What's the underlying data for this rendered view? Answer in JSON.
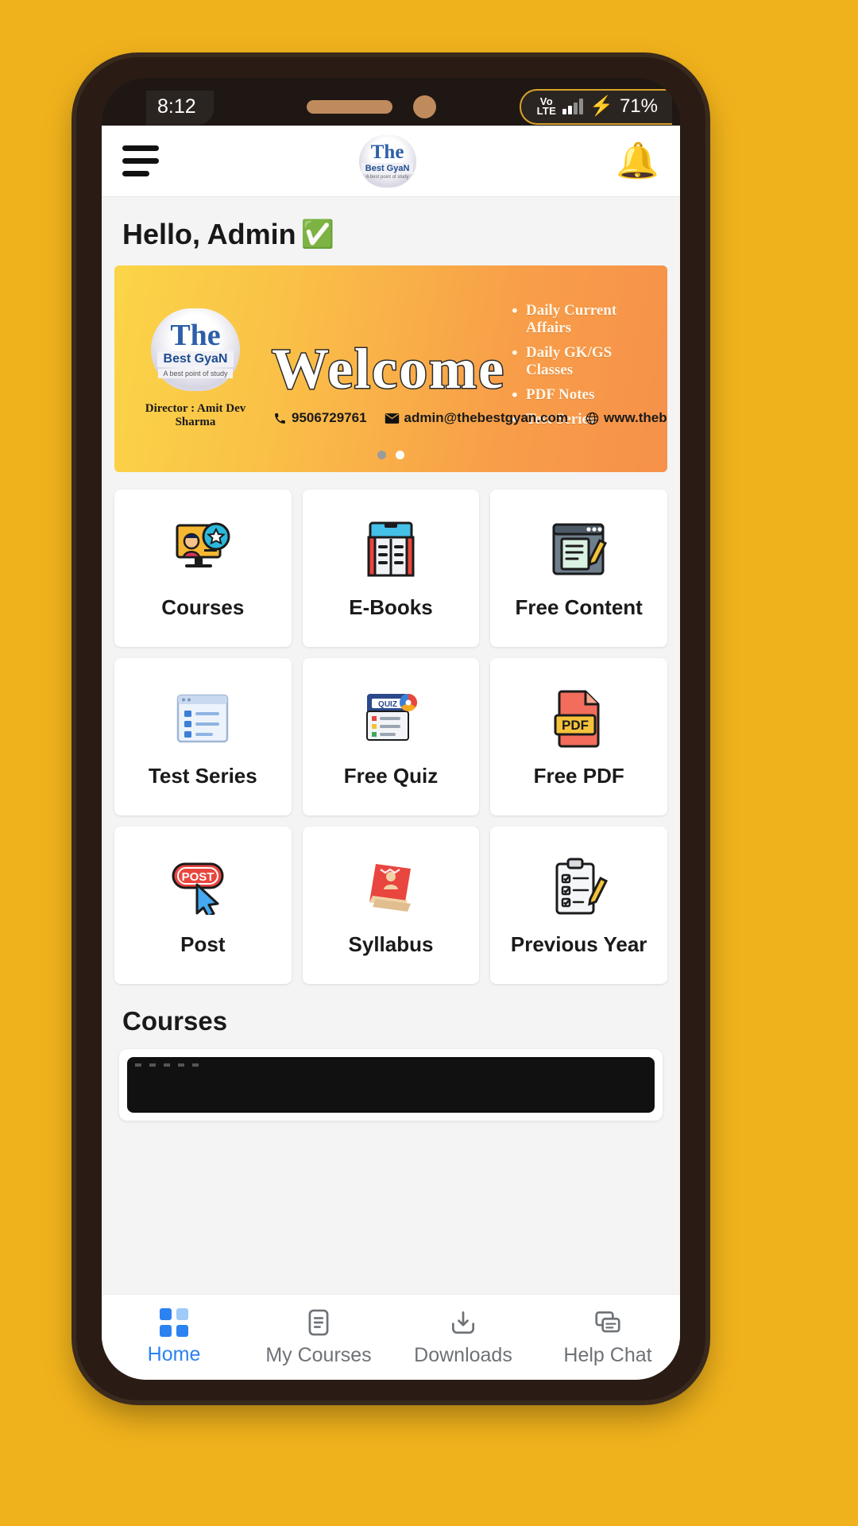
{
  "status_bar": {
    "time": "8:12",
    "network_label": "VoLTE",
    "charging_icon": "lightning-bolt-icon",
    "battery": "71%"
  },
  "app_bar": {
    "menu_icon": "hamburger-menu-icon",
    "logo": {
      "word_mark": "The",
      "sub_mark": "Best GyaN",
      "tagline": "A best point of study"
    },
    "notification_icon": "bell-icon"
  },
  "greeting": {
    "text": "Hello, Admin",
    "emoji": "✅"
  },
  "banner": {
    "headline": "Welcome",
    "director": "Director : Amit Dev Sharma",
    "features": [
      "Daily Current Affairs",
      "Daily GK/GS Classes",
      "PDF Notes",
      "Test Series"
    ],
    "contacts": {
      "phone": "9506729761",
      "email": "admin@thebestgyan.com",
      "website": "www.thebestgyan.com"
    },
    "logo": {
      "word_mark": "The",
      "sub_mark": "Best GyaN",
      "tagline": "A best point of study"
    },
    "carousel": {
      "total_dots": 2,
      "active_index": 1
    },
    "colors": {
      "gradient_start": "#FBD547",
      "gradient_end": "#F6914A"
    }
  },
  "tiles": [
    {
      "label": "Courses",
      "icon": "teacher-presentation-icon"
    },
    {
      "label": "E-Books",
      "icon": "open-book-tablet-icon"
    },
    {
      "label": "Free Content",
      "icon": "notes-pencil-window-icon"
    },
    {
      "label": "Test Series",
      "icon": "list-window-icon"
    },
    {
      "label": "Free Quiz",
      "icon": "quiz-screen-icon"
    },
    {
      "label": "Free PDF",
      "icon": "pdf-file-icon"
    },
    {
      "label": "Post",
      "icon": "post-cursor-icon"
    },
    {
      "label": "Syllabus",
      "icon": "red-book-icon"
    },
    {
      "label": "Previous Year",
      "icon": "clipboard-checklist-icon"
    }
  ],
  "sections": {
    "courses_title": "Courses"
  },
  "bottom_nav": {
    "active_color": "#2C82F0",
    "items": [
      {
        "label": "Home",
        "icon": "grid-squares-icon",
        "active": true
      },
      {
        "label": "My Courses",
        "icon": "document-lines-icon",
        "active": false
      },
      {
        "label": "Downloads",
        "icon": "download-tray-icon",
        "active": false
      },
      {
        "label": "Help Chat",
        "icon": "chat-bubbles-icon",
        "active": false
      }
    ]
  }
}
